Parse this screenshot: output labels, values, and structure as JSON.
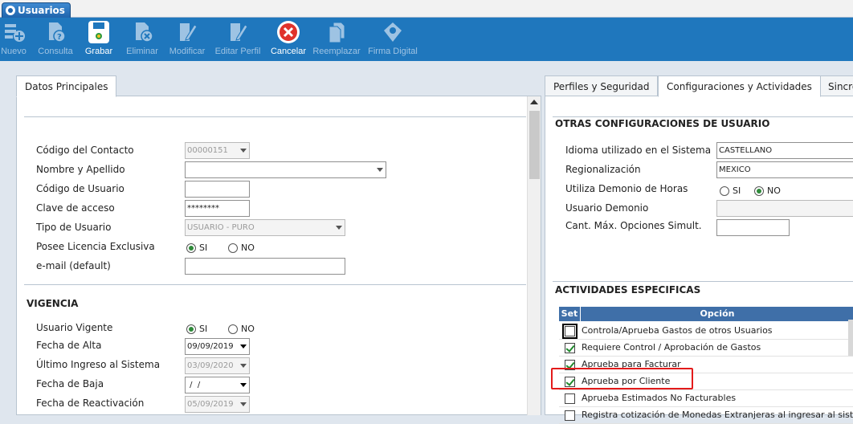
{
  "window": {
    "tab_title": "Usuarios"
  },
  "toolbar": {
    "buttons": [
      {
        "label": "Nuevo",
        "icon": "add-document-icon",
        "active": false
      },
      {
        "label": "Consulta",
        "icon": "query-document-icon",
        "active": false
      },
      {
        "label": "Grabar",
        "icon": "save-disk-icon",
        "active": true
      },
      {
        "label": "Eliminar",
        "icon": "delete-document-icon",
        "active": false
      },
      {
        "label": "Modificar",
        "icon": "edit-pencil-icon",
        "active": false
      },
      {
        "label": "Editar Perfil",
        "icon": "edit-profile-icon",
        "active": false
      },
      {
        "label": "Cancelar",
        "icon": "cancel-x-icon",
        "active": true
      },
      {
        "label": "Reemplazar",
        "icon": "replace-copy-icon",
        "active": false
      },
      {
        "label": "Firma Digital",
        "icon": "digital-signature-icon",
        "active": false
      }
    ]
  },
  "left": {
    "tab": "Datos Principales",
    "fields": {
      "codigo_contacto": {
        "label": "Código del Contacto",
        "value": "00000151"
      },
      "nombre": {
        "label": "Nombre y Apellido",
        "value": ""
      },
      "codigo_usuario": {
        "label": "Código de Usuario",
        "value": ""
      },
      "clave": {
        "label": "Clave de acceso",
        "value": "********"
      },
      "tipo_usuario": {
        "label": "Tipo de Usuario",
        "value": "USUARIO - PURO"
      },
      "licencia": {
        "label": "Posee Licencia Exclusiva",
        "si": "SI",
        "no": "NO",
        "selected": "SI"
      },
      "email": {
        "label": "e-mail (default)",
        "value": ""
      }
    },
    "vigencia": {
      "title": "VIGENCIA",
      "usuario_vigente": {
        "label": "Usuario Vigente",
        "si": "SI",
        "no": "NO",
        "selected": "SI"
      },
      "fecha_alta": {
        "label": "Fecha de Alta",
        "value": "09/09/2019"
      },
      "ultimo_ingreso": {
        "label": "Último Ingreso al Sistema",
        "value": "03/09/2020"
      },
      "fecha_baja": {
        "label": "Fecha de Baja",
        "value": " /  /"
      },
      "fecha_reactivacion": {
        "label": "Fecha de Reactivación",
        "value": "05/09/2019"
      }
    }
  },
  "right": {
    "tabs": [
      "Perfiles y Seguridad",
      "Configuraciones y Actividades",
      "Sincro"
    ],
    "selected_tab": "Configuraciones y Actividades",
    "otras": {
      "title": "OTRAS CONFIGURACIONES DE USUARIO",
      "idioma": {
        "label": "Idioma utilizado en el Sistema",
        "value": "CASTELLANO"
      },
      "regionalizacion": {
        "label": "Regionalización",
        "value": "MEXICO"
      },
      "demonio_horas": {
        "label": "Utiliza Demonio de Horas",
        "si": "SI",
        "no": "NO",
        "selected": "NO"
      },
      "usuario_demonio": {
        "label": "Usuario Demonio",
        "value": ""
      },
      "cant_max": {
        "label": "Cant. Máx. Opciones Simult.",
        "value": ""
      }
    },
    "actividades": {
      "title": "ACTIVIDADES ESPECIFICAS",
      "col_set": "Set",
      "col_opcion": "Opción",
      "rows": [
        {
          "text": "Controla/Aprueba Gastos de otros Usuarios",
          "checked": false
        },
        {
          "text": "Requiere Control / Aprobación de Gastos",
          "checked": true
        },
        {
          "text": "Aprueba para Facturar",
          "checked": true
        },
        {
          "text": "Aprueba por Cliente",
          "checked": true
        },
        {
          "text": "Aprueba Estimados No Facturables",
          "checked": false
        },
        {
          "text": "Registra cotización de Monedas Extranjeras al ingresar al sistema",
          "checked": false
        }
      ]
    }
  },
  "colors": {
    "toolbar_bg": "#1f77bd",
    "grid_header": "#3f6fa8",
    "highlight": "#e31b1b"
  }
}
